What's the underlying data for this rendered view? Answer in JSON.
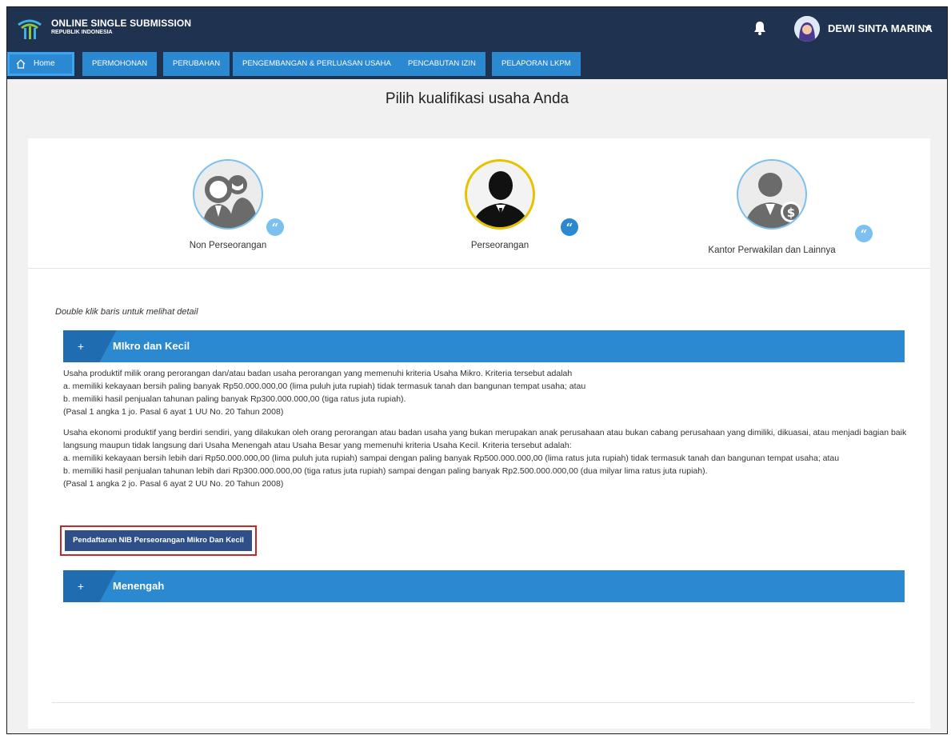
{
  "app": {
    "title_line1": "ONLINE SINGLE SUBMISSION",
    "title_line2": "REPUBLIK INDONESIA",
    "username": "DEWI SINTA MARINA"
  },
  "nav": {
    "home": "Home",
    "items": [
      "PERMOHONAN",
      "PERUBAHAN",
      "PENGEMBANGAN & PERLUASAN USAHA",
      "PENCABUTAN IZIN",
      "PELAPORAN LKPM"
    ]
  },
  "page": {
    "title": "Pilih kualifikasi usaha Anda",
    "hint": "Double klik baris untuk melihat detail"
  },
  "types": [
    {
      "label": "Non Perseorangan",
      "selected": false
    },
    {
      "label": "Perseorangan",
      "selected": true
    },
    {
      "label": "Kantor Perwakilan dan Lainnya",
      "selected": false
    }
  ],
  "quote_glyph": "“",
  "accordion": {
    "plus": "+",
    "mikro": {
      "title": "MIkro dan Kecil",
      "p1": [
        "Usaha produktif milik orang perorangan dan/atau badan usaha perorangan yang memenuhi kriteria Usaha Mikro. Kriteria tersebut adalah",
        "a. memiliki kekayaan bersih paling banyak Rp50.000.000,00 (lima puluh juta rupiah) tidak termasuk tanah dan bangunan tempat usaha; atau",
        "b. memiliki hasil penjualan tahunan paling banyak Rp300.000.000,00 (tiga ratus juta rupiah).",
        "(Pasal 1 angka 1 jo. Pasal 6 ayat 1 UU No. 20 Tahun 2008)"
      ],
      "p2": [
        "Usaha ekonomi produktif yang berdiri sendiri, yang dilakukan oleh orang perorangan atau badan usaha yang bukan merupakan anak perusahaan atau bukan cabang perusahaan yang dimiliki, dikuasai, atau menjadi bagian baik langsung maupun tidak langsung dari Usaha Menengah atau Usaha Besar yang memenuhi kriteria Usaha Kecil. Kriteria tersebut adalah:",
        "a. memiliki kekayaan bersih lebih dari Rp50.000.000,00 (lima puluh juta rupiah) sampai dengan paling banyak Rp500.000.000,00 (lima ratus juta rupiah) tidak termasuk tanah dan bangunan tempat usaha; atau",
        "b. memiliki hasil penjualan tahunan lebih dari Rp300.000.000,00 (tiga ratus juta rupiah) sampai dengan paling banyak Rp2.500.000.000,00 (dua milyar lima ratus juta rupiah).",
        "(Pasal 1 angka 2 jo. Pasal 6 ayat 2 UU No. 20 Tahun 2008)"
      ],
      "button": "Pendaftaran NIB Perseorangan Mikro Dan Kecil"
    },
    "menengah": {
      "title": "Menengah"
    }
  },
  "colors": {
    "topbar": "#1f3350",
    "nav_button": "#2b89d2",
    "accordion": "#2b89d2",
    "primary_button": "#2e4f8a",
    "highlight": "#c62828",
    "selected_ring": "#e6c200"
  }
}
